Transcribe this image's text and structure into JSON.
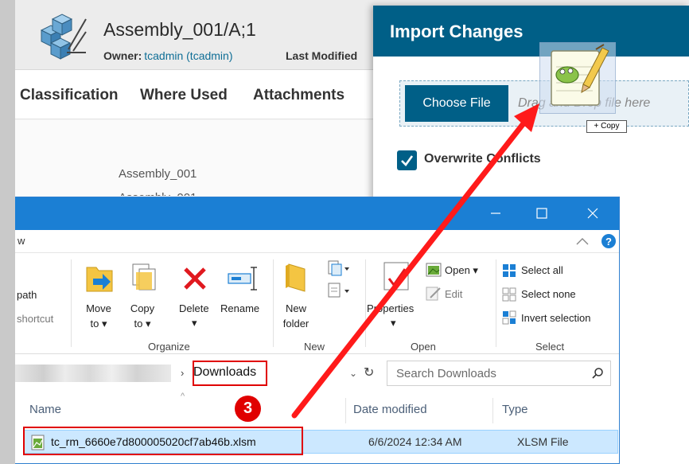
{
  "app": {
    "title": "Assembly_001/A;1",
    "owner_label": "Owner:",
    "owner_value": "tcadmin (tcadmin)",
    "last_modified_label": "Last Modified",
    "tabs": [
      {
        "label": "Classification"
      },
      {
        "label": "Where Used"
      },
      {
        "label": "Attachments"
      }
    ],
    "content": {
      "item_name": "Assembly_001",
      "item_name_partial": "Assembly_001"
    }
  },
  "import_panel": {
    "title": "Import Changes",
    "choose_file_label": "Choose File",
    "drop_hint": "Drag and Drop file here",
    "overwrite_label": "Overwrite Conflicts",
    "overwrite_checked": true
  },
  "drag": {
    "copy_tip": "+ Copy"
  },
  "explorer": {
    "ribbon_tab_partial": "w",
    "groups": {
      "left_partial": {
        "path_label": "path",
        "shortcut_label": "shortcut"
      },
      "organize": {
        "label": "Organize",
        "move_to": "Move",
        "move_to_2": "to",
        "copy_to": "Copy",
        "copy_to_2": "to",
        "delete": "Delete",
        "rename": "Rename"
      },
      "new": {
        "label": "New",
        "new_folder": "New",
        "new_folder_2": "folder"
      },
      "open": {
        "label": "Open",
        "open": "Open",
        "edit": "Edit",
        "properties": "Properties"
      },
      "select": {
        "label": "Select",
        "select_all": "Select all",
        "select_none": "Select none",
        "invert_selection": "Invert selection"
      }
    },
    "address": {
      "location": "Downloads",
      "search_placeholder": "Search Downloads"
    },
    "columns": {
      "name": "Name",
      "date_modified": "Date modified",
      "type": "Type"
    },
    "files": [
      {
        "name": "tc_rm_6660e7d800005020cf7ab46b.xlsm",
        "date": "6/6/2024 12:34 AM",
        "type": "XLSM File"
      }
    ]
  },
  "annotation": {
    "step": "3",
    "color": "#e00000"
  },
  "colors": {
    "accent": "#005f87",
    "explorer_titlebar": "#1b7fd4",
    "selection": "#cce8ff"
  }
}
